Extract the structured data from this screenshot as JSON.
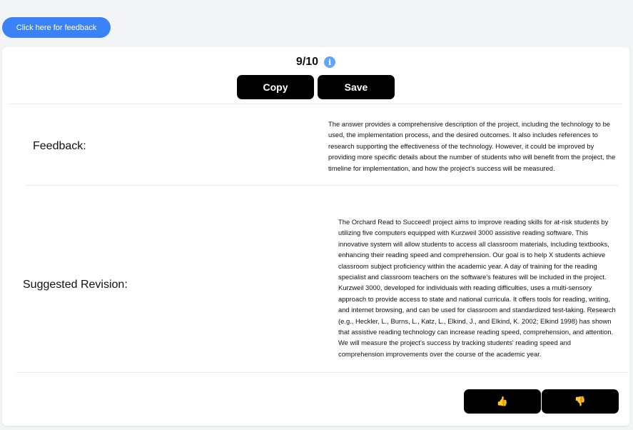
{
  "header": {
    "feedback_button_label": "Click here for feedback"
  },
  "score": {
    "value": "9/10",
    "info_glyph": "i"
  },
  "actions": {
    "copy_label": "Copy",
    "save_label": "Save"
  },
  "feedback": {
    "label": "Feedback:",
    "text": "The answer provides a comprehensive description of the project, including the technology to be used, the implementation process, and the desired outcomes. It also includes references to research supporting the effectiveness of the technology. However, it could be improved by providing more specific details about the number of students who will benefit from the project, the timeline for implementation, and how the project's success will be measured."
  },
  "revision": {
    "label": "Suggested Revision:",
    "text": "The Orchard Read to Succeed! project aims to improve reading skills for at-risk students by utilizing five computers equipped with Kurzweil 3000 assistive reading software. This innovative system will allow students to access all classroom materials, including textbooks, enhancing their reading speed and comprehension. Our goal is to help X students achieve classroom subject proficiency within the academic year. A day of training for the reading specialist and classroom teachers on the software's features will be included in the project. Kurzweil 3000, developed for individuals with reading difficulties, uses a multi-sensory approach to provide access to state and national curricula. It offers tools for reading, writing, and internet browsing, and can be used for classroom and standardized test-taking. Research (e.g., Heckler, L., Burns, L., Katz, L., Elkind, J., and Elkind, K. 2002; Elkind 1998) has shown that assistive reading technology can increase reading speed, comprehension, and attention. We will measure the project's success by tracking students' reading speed and comprehension improvements over the course of the academic year."
  },
  "votes": {
    "up_icon": "thumbs-up-icon",
    "down_icon": "thumbs-down-icon",
    "up_glyph": "👍",
    "down_glyph": "👎"
  },
  "colors": {
    "accent": "#3b82f6",
    "info": "#60a5fa",
    "button_dark": "#000000",
    "background": "#f3f4f6"
  }
}
